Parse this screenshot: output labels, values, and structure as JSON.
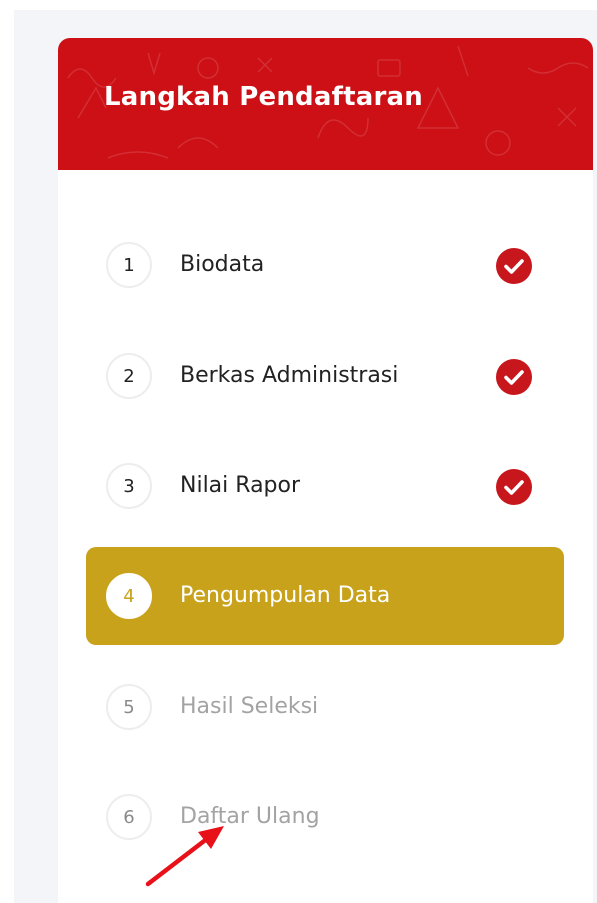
{
  "panel": {
    "title": "Langkah Pendaftaran"
  },
  "steps": [
    {
      "number": "1",
      "label": "Biodata",
      "status": "done",
      "icon": "check-circle-icon"
    },
    {
      "number": "2",
      "label": "Berkas Administrasi",
      "status": "done",
      "icon": "check-circle-icon"
    },
    {
      "number": "3",
      "label": "Nilai Rapor",
      "status": "done",
      "icon": "check-circle-icon"
    },
    {
      "number": "4",
      "label": "Pengumpulan Data",
      "status": "active"
    },
    {
      "number": "5",
      "label": "Hasil Seleksi",
      "status": "disabled"
    },
    {
      "number": "6",
      "label": "Daftar Ulang",
      "status": "disabled"
    }
  ],
  "colors": {
    "header_red": "#cc1016",
    "active_gold": "#c9a21b",
    "check_red": "#c8161d",
    "annotation_arrow": "#e8111a"
  }
}
